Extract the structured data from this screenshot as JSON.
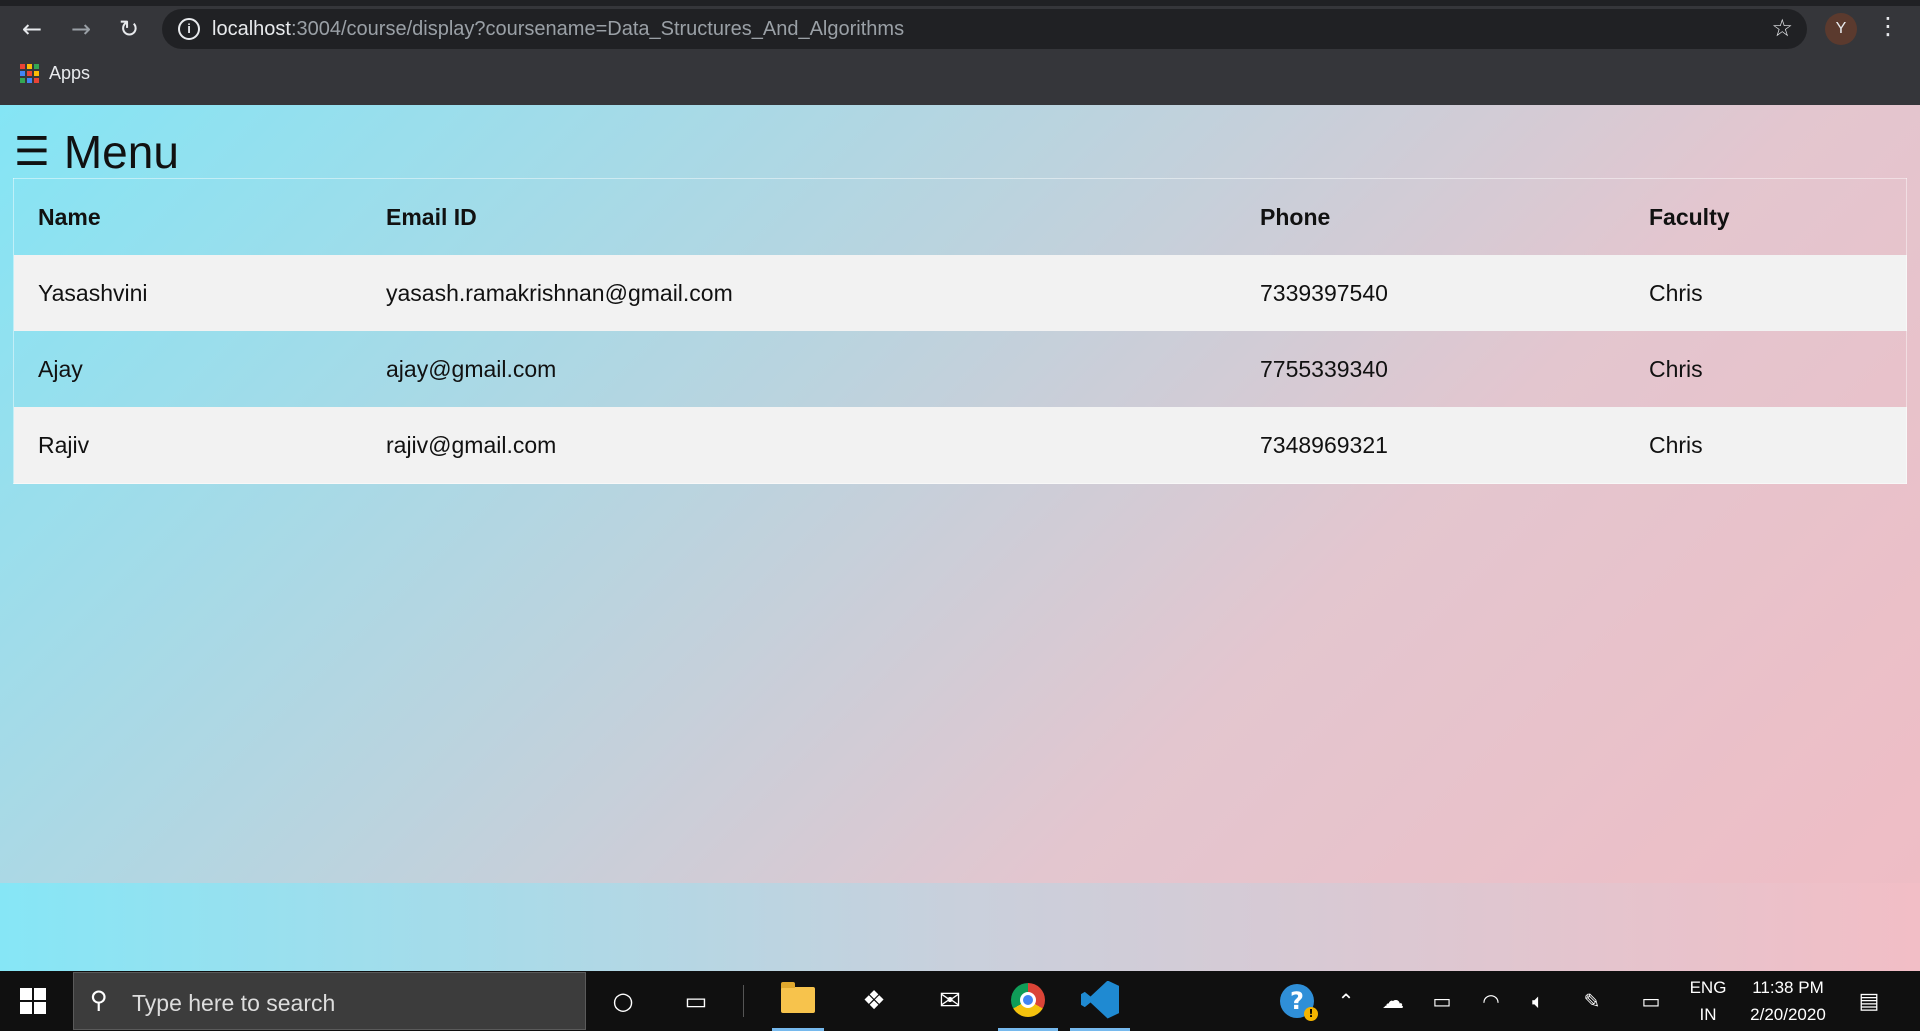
{
  "browser": {
    "url_host": "localhost",
    "url_rest": ":3004/course/display?coursename=Data_Structures_And_Algorithms",
    "profile_initial": "Y",
    "bookmarks": {
      "apps_label": "Apps"
    },
    "icons": [
      "back-arrow-icon",
      "forward-arrow-icon",
      "reload-icon",
      "info-icon",
      "star-icon",
      "kebab-menu-icon",
      "apps-grid-icon"
    ],
    "apps_grid_colors": [
      "#ea4335",
      "#fbbc05",
      "#34a853",
      "#4285f4",
      "#ea4335",
      "#fbbc05",
      "#34a853",
      "#4285f4",
      "#ea4335"
    ]
  },
  "page": {
    "menu_icon": "☰",
    "menu_label": "Menu",
    "table": {
      "headers": [
        "Name",
        "Email ID",
        "Phone",
        "Faculty"
      ],
      "rows": [
        [
          "Yasashvini",
          "yasash.ramakrishnan@gmail.com",
          "7339397540",
          "Chris"
        ],
        [
          "Ajay",
          "ajay@gmail.com",
          "7755339340",
          "Chris"
        ],
        [
          "Rajiv",
          "rajiv@gmail.com",
          "7348969321",
          "Chris"
        ]
      ]
    }
  },
  "taskbar": {
    "search_placeholder": "Type here to search",
    "apps": [
      "windows-start-icon",
      "cortana-icon",
      "task-view-icon",
      "file-explorer-icon",
      "dropbox-icon",
      "mail-icon",
      "chrome-icon",
      "vscode-icon"
    ],
    "tray_icons": [
      "help-icon",
      "chevron-up-icon",
      "onedrive-icon",
      "battery-icon",
      "wifi-icon",
      "volume-icon",
      "pen-icon",
      "tablet-icon"
    ],
    "language": "ENG",
    "region": "IN",
    "time": "11:38 PM",
    "date": "2/20/2020",
    "notification_icon": "action-center-icon"
  },
  "colors": {
    "gradient_start": "#84e5f5",
    "gradient_end": "#f0bcc4",
    "row_light": "#f2f2f2",
    "chrome_bg": "#35363a",
    "taskbar_bg": "#101010"
  }
}
